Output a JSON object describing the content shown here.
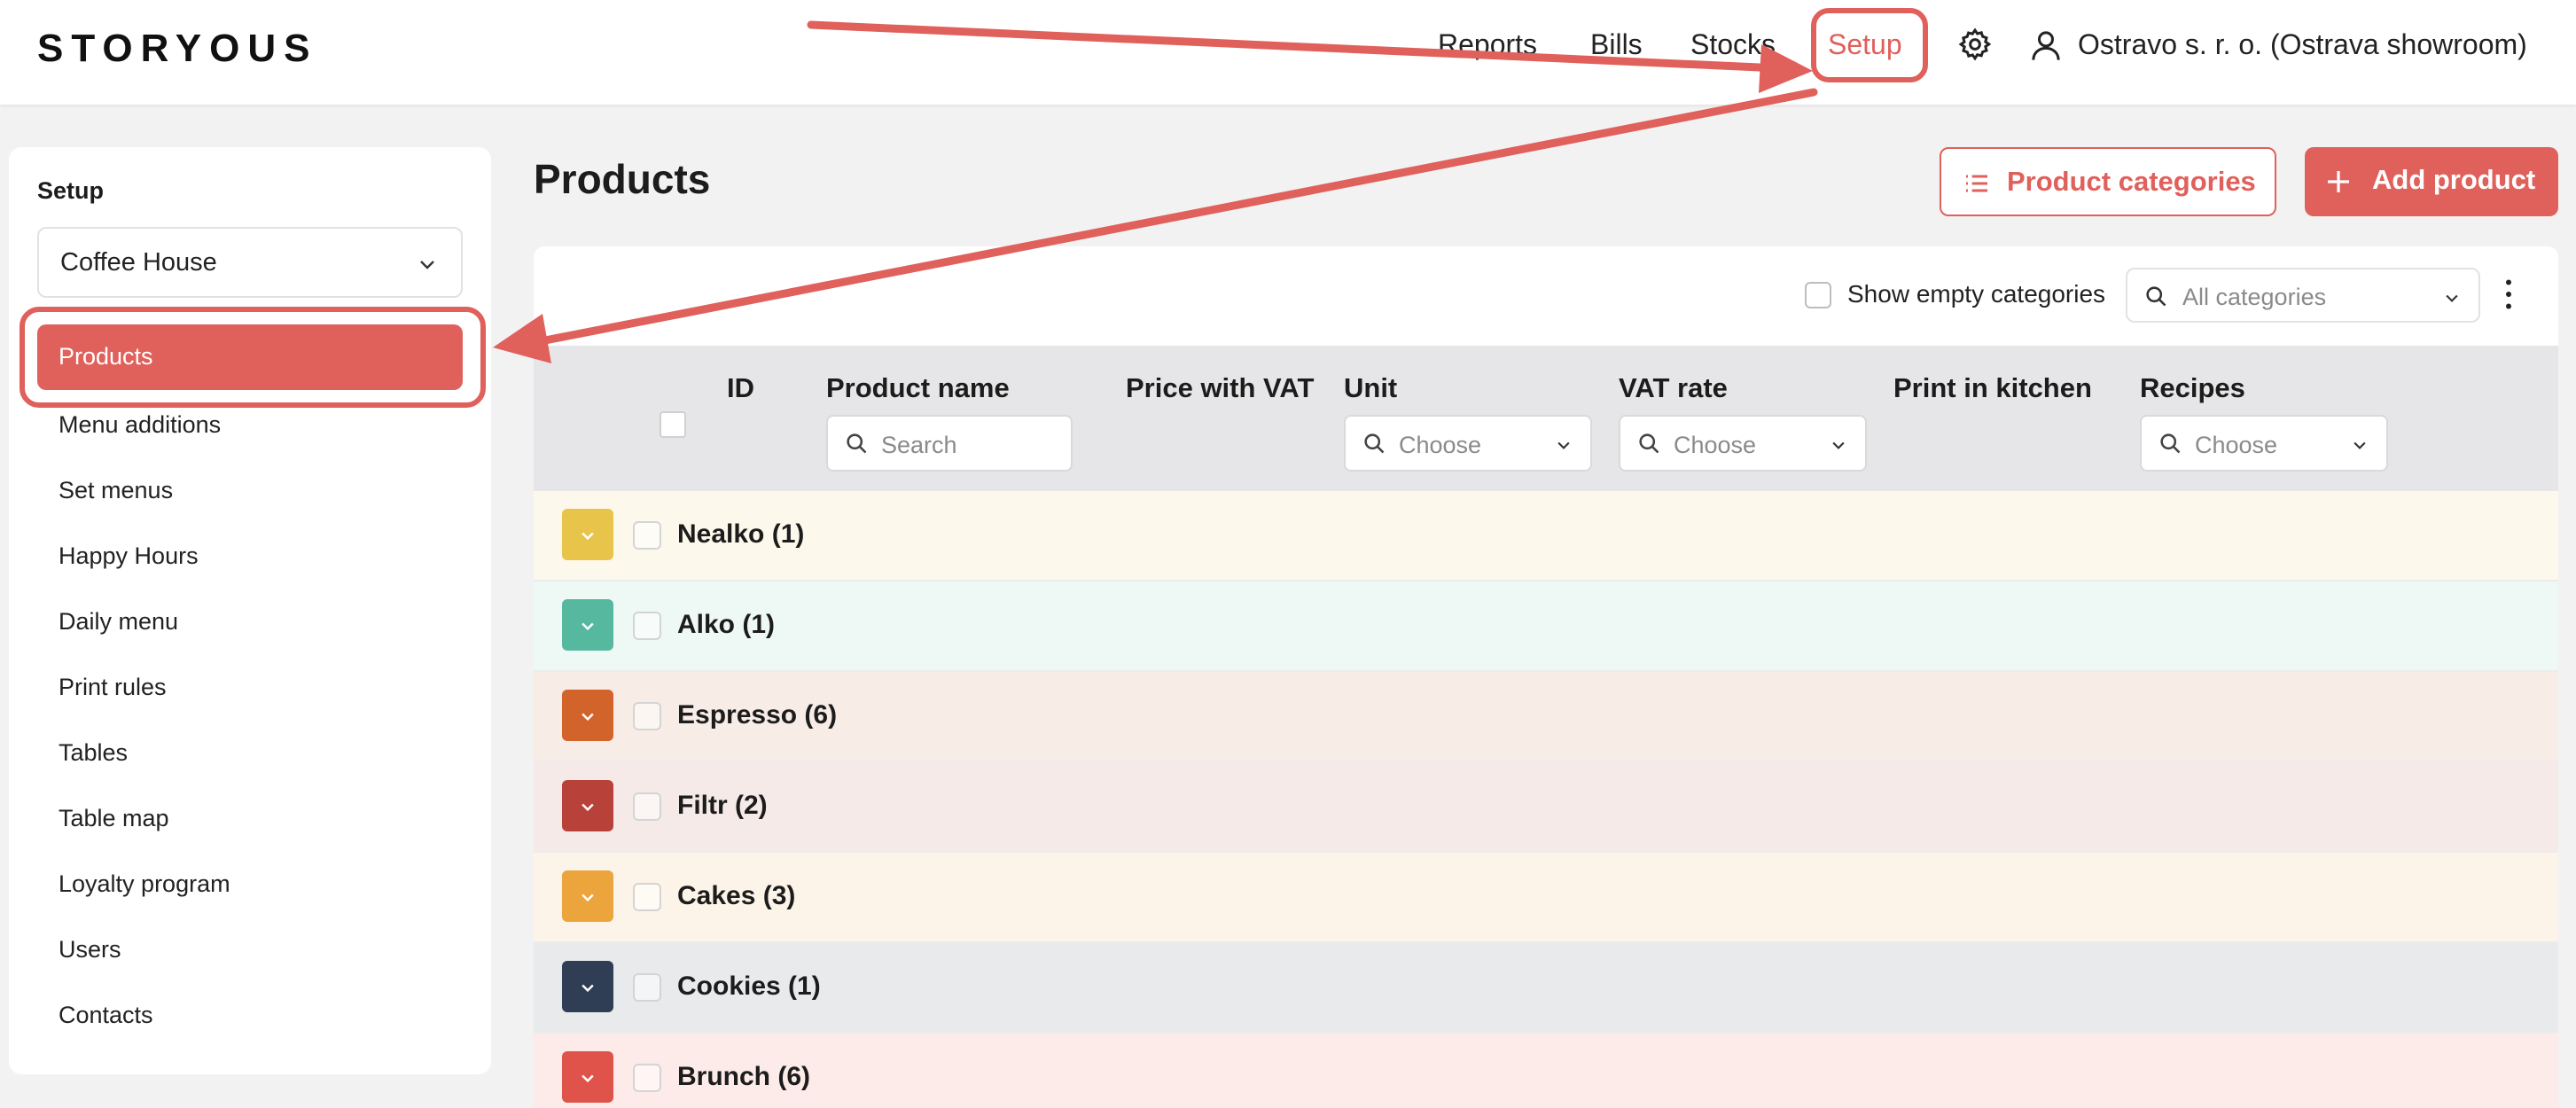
{
  "app": {
    "logo": "STORYOUS"
  },
  "nav": {
    "items": [
      {
        "label": "Reports"
      },
      {
        "label": "Bills"
      },
      {
        "label": "Stocks"
      },
      {
        "label": "Setup"
      }
    ],
    "company": "Ostravo s. r. o. (Ostrava showroom)"
  },
  "sidebar": {
    "title": "Setup",
    "venue": "Coffee House",
    "items": [
      {
        "label": "Products"
      },
      {
        "label": "Menu additions"
      },
      {
        "label": "Set menus"
      },
      {
        "label": "Happy Hours"
      },
      {
        "label": "Daily menu"
      },
      {
        "label": "Print rules"
      },
      {
        "label": "Tables"
      },
      {
        "label": "Table map"
      },
      {
        "label": "Loyalty program"
      },
      {
        "label": "Users"
      },
      {
        "label": "Contacts"
      }
    ]
  },
  "main": {
    "title": "Products",
    "categories_button": "Product categories",
    "add_button": "Add product",
    "show_empty_label": "Show empty categories",
    "category_filter_placeholder": "All categories",
    "columns": {
      "id": "ID",
      "name": "Product name",
      "price": "Price with VAT",
      "unit": "Unit",
      "vat": "VAT rate",
      "kitchen": "Print in kitchen",
      "recipes": "Recipes"
    },
    "filters": {
      "search_placeholder": "Search",
      "choose": "Choose"
    },
    "categories": [
      {
        "label": "Nealko (1)",
        "color": "#e9c44a",
        "bg": "#fdf8ec"
      },
      {
        "label": "Alko (1)",
        "color": "#57b8a0",
        "bg": "#eef8f5"
      },
      {
        "label": "Espresso (6)",
        "color": "#d2632a",
        "bg": "#f8ece7"
      },
      {
        "label": "Filtr (2)",
        "color": "#b8413a",
        "bg": "#f6eae9"
      },
      {
        "label": "Cakes (3)",
        "color": "#eca43c",
        "bg": "#fdf4e9"
      },
      {
        "label": "Cookies (1)",
        "color": "#2f3e55",
        "bg": "#e9eaec"
      },
      {
        "label": "Brunch (6)",
        "color": "#e0534b",
        "bg": "#fcebe9"
      }
    ]
  },
  "colors": {
    "accent": "#e0605b"
  }
}
